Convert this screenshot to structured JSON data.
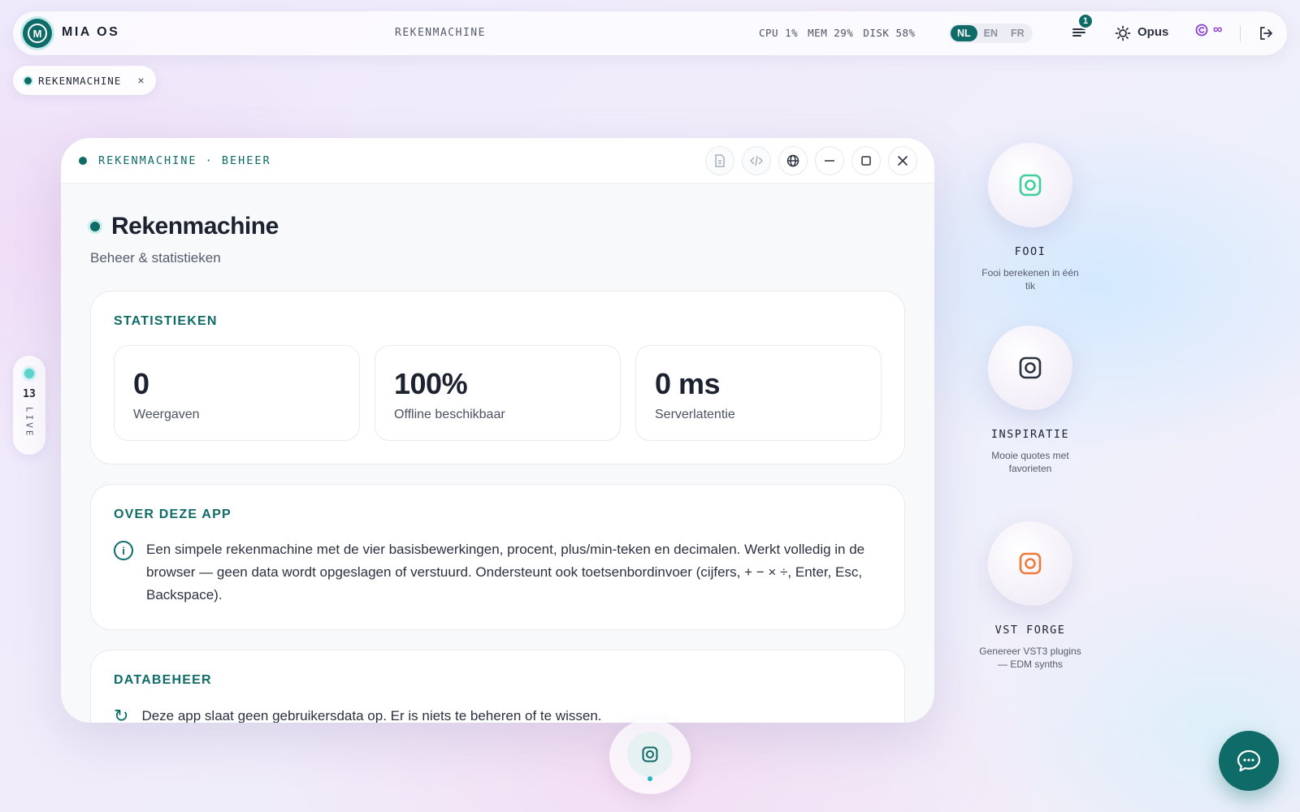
{
  "topbar": {
    "logo_letter": "M",
    "brand": "MIA OS",
    "app_title": "REKENMACHINE",
    "stats": {
      "cpu": "CPU 1%",
      "mem": "MEM 29%",
      "disk": "DISK 58%"
    },
    "languages": [
      {
        "code": "NL",
        "active": true
      },
      {
        "code": "EN",
        "active": false
      },
      {
        "code": "FR",
        "active": false
      }
    ],
    "notification_count": "1",
    "model": "Opus",
    "credits": "∞"
  },
  "open_apps": [
    {
      "label": "REKENMACHINE",
      "close": "×"
    }
  ],
  "live": {
    "count": "13",
    "label": "LIVE"
  },
  "window": {
    "breadcrumb": "REKENMACHINE · BEHEER",
    "title": "Rekenmachine",
    "subtitle": "Beheer & statistieken",
    "stats_card": {
      "title": "STATISTIEKEN",
      "items": [
        {
          "value": "0",
          "label": "Weergaven"
        },
        {
          "value": "100%",
          "label": "Offline beschikbaar"
        },
        {
          "value": "0 ms",
          "label": "Serverlatentie"
        }
      ]
    },
    "about_card": {
      "title": "OVER DEZE APP",
      "text": "Een simpele rekenmachine met de vier basisbewerkingen, procent, plus/min-teken en decimalen. Werkt volledig in de browser — geen data wordt opgeslagen of verstuurd. Ondersteunt ook toetsenbordinvoer (cijfers, + − × ÷, Enter, Esc, Backspace)."
    },
    "data_card": {
      "title": "DATABEHEER",
      "text": "Deze app slaat geen gebruikersdata op. Er is niets te beheren of te wissen."
    }
  },
  "launchers": [
    {
      "name": "FOOI",
      "description": "Fooi berekenen in één tik",
      "color": "#3fcf9a"
    },
    {
      "name": "INSPIRATIE",
      "description": "Mooie quotes met favorieten",
      "color": "#2b3140"
    },
    {
      "name": "VST FORGE",
      "description": "Genereer VST3 plugins — EDM synths",
      "color": "#f07a3a"
    }
  ],
  "colors": {
    "accent": "#0f6b68",
    "credits": "#8a3fd1"
  }
}
